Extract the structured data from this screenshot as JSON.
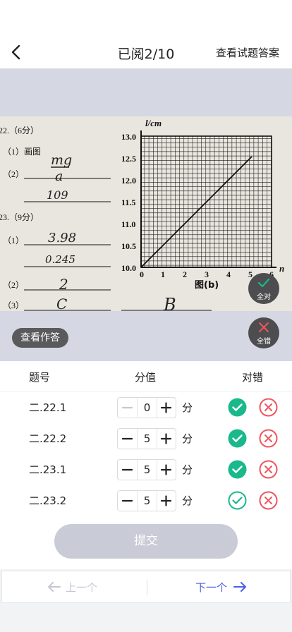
{
  "header": {
    "title": "已阅2/10",
    "answers_link": "查看试题答案"
  },
  "overlay": {
    "all_correct": "全对",
    "all_wrong": "全错",
    "view_answer": "查看作答"
  },
  "scan": {
    "q22": "22.（6分）",
    "q22_1": "（1）画图",
    "q22_2": "（2）",
    "q22_2_numerator": "mg",
    "q22_2_denominator": "a",
    "q22_2_value": "109",
    "q23": "23.（9分）",
    "q23_1": "（1）",
    "q23_1_a": "3.98",
    "q23_1_b": "0.245",
    "q23_2": "（2）",
    "q23_2_a": "2",
    "q23_3": "（3）",
    "q23_3_a": "C",
    "q23_3_b": "B",
    "graph_ylabel": "l/cm",
    "graph_xlabel": "n",
    "graph_caption": "图(b)",
    "y_ticks": [
      "13.0",
      "12.5",
      "12.0",
      "11.5",
      "11.0",
      "10.5",
      "10.0"
    ],
    "x_ticks": [
      "0",
      "1",
      "2",
      "3",
      "4",
      "5",
      "6"
    ]
  },
  "table": {
    "col_question": "题号",
    "col_score": "分值",
    "col_result": "对错",
    "unit": "分",
    "rows": [
      {
        "id": "二.22.1",
        "score": "0",
        "status": "correct",
        "minus_disabled": true
      },
      {
        "id": "二.22.2",
        "score": "5",
        "status": "correct",
        "minus_disabled": false
      },
      {
        "id": "二.23.1",
        "score": "5",
        "status": "correct",
        "minus_disabled": false
      },
      {
        "id": "二.23.2",
        "score": "5",
        "status": "unset",
        "minus_disabled": false
      }
    ]
  },
  "submit_label": "提交",
  "nav": {
    "prev_label": "上一个",
    "next_label": "下一个"
  },
  "colors": {
    "green": "#19b98c",
    "red": "#f0545e",
    "blue": "#4a5fe8",
    "disabled": "#c9ccd6"
  }
}
